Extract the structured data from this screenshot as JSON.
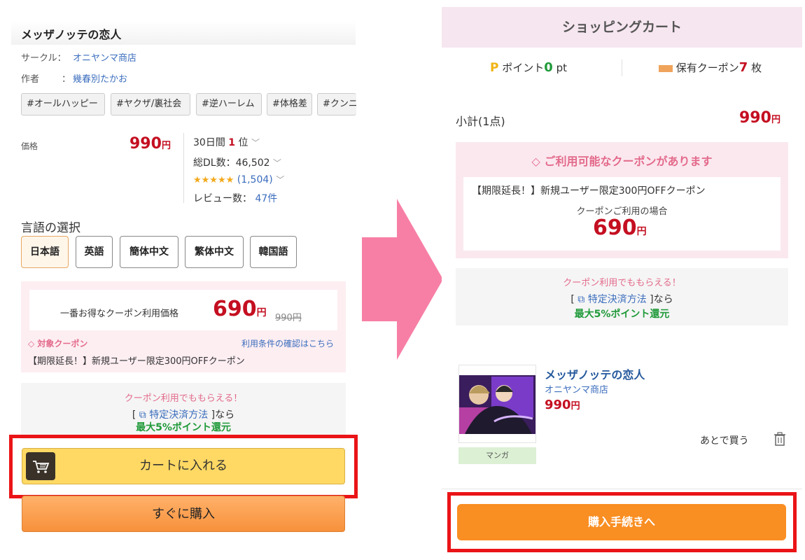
{
  "left": {
    "title": "メッザノッテの恋人",
    "circle_label": "サークル：",
    "circle_value": "オニヤンマ商店",
    "author_label": "作者",
    "author_sep": "：",
    "author_value": "幾春別たかお",
    "tags": [
      "#オールハッピー",
      "#ヤクザ/裏社会",
      "#逆ハーレム",
      "#体格差",
      "#クンニ"
    ],
    "price_label": "価格",
    "price_value": "990",
    "yen": "円",
    "rank_prefix": "30日間",
    "rank_value": "1",
    "rank_suffix": "位",
    "downloads": "総DL数：46,502",
    "stars": "★★★★★",
    "rating_count": "(1,504)",
    "reviews_label": "レビュー数：",
    "reviews_value": "47件",
    "language_heading": "言語の選択",
    "languages": [
      "日本語",
      "英語",
      "簡体中文",
      "繁体中文",
      "韓国語"
    ],
    "best_coupon_label": "一番お得なクーポン利用価格",
    "coupon_price": "690",
    "original_price": "990円",
    "target_coupon": "対象クーポン",
    "terms_link": "利用条件の確認はこちら",
    "coupon_name": "【期限延長！】新規ユーザー限定300円OFFクーポン",
    "points_promo": "クーポン利用でももらえる！",
    "payment_open": "[",
    "payment_link": "特定決済方法",
    "payment_close": "]なら",
    "points_max": "最大5%ポイント還元",
    "add_to_cart": "カートに入れる",
    "buy_now": "すぐに購入"
  },
  "right": {
    "header": "ショッピングカート",
    "points_icon": "P",
    "points_label": "ポイント",
    "points_value": "0",
    "points_unit": "pt",
    "coupons_label": "保有クーポン",
    "coupons_value": "7",
    "coupons_unit": "枚",
    "subtotal_label": "小計(1点)",
    "subtotal_value": "990",
    "yen": "円",
    "coupon_available": "ご利用可能なクーポンがあります",
    "coupon_name": "【期限延長！】新規ユーザー限定300円OFFクーポン",
    "coupon_use_label": "クーポンご利用の場合",
    "coupon_price": "690",
    "points_promo": "クーポン利用でももらえる！",
    "payment_open": "[",
    "payment_link": "特定決済方法",
    "payment_close": "]なら",
    "points_max": "最大5%ポイント還元",
    "item_title": "メッザノッテの恋人",
    "item_circle": "オニヤンマ商店",
    "item_price": "990",
    "item_category": "マンガ",
    "save_for_later": "あとで買う",
    "proceed": "購入手続きへ"
  },
  "colors": {
    "price_red": "#c40f21",
    "highlight_frame": "#ea1417",
    "arrow_pink": "#f77fa5",
    "cart_button": "#ffd964",
    "buy_button": "#f7913b",
    "proceed_button": "#f98e22",
    "link_blue": "#3b6dbd"
  }
}
